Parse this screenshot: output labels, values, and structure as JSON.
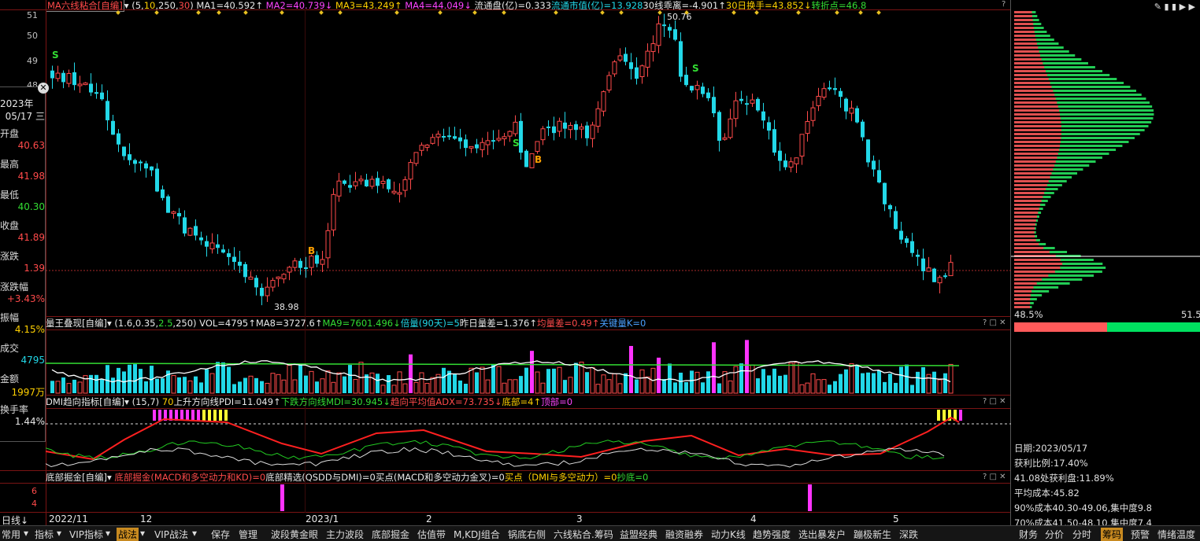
{
  "main_header": {
    "indicator": "MA六线粘合[自编]",
    "params_prefix": "(",
    "p1": "5",
    "c1": ",",
    "p2": "10",
    "c2": ",",
    "p3": "250",
    "c3": ",",
    "p4": "30",
    "params_suffix": ")",
    "ma1": "MA1=40.592↑",
    "ma2": "MA2=40.739↓",
    "ma3": "MA3=43.249↑",
    "ma4": "MA4=44.049↓",
    "flow": "流通盘(亿)=0.333",
    "mktval": "流通市值(亿)=13.928",
    "dev": "30线乖离=-4.901↑",
    "turn": "30日换手=43.852↓",
    "pivot": "转折点=46.8"
  },
  "price_labels": {
    "high": "50.76",
    "low": "38.98"
  },
  "y_ticks": [
    "51",
    "50",
    "49",
    "48"
  ],
  "signals": {
    "s": "S",
    "b": "B"
  },
  "info_panel": {
    "year": "2023年",
    "date": "05/17 三",
    "open_label": "开盘",
    "open": "40.63",
    "high_label": "最高",
    "high": "41.98",
    "low_label": "最低",
    "low": "40.30",
    "close_label": "收盘",
    "close": "41.89",
    "chg_label": "涨跌",
    "chg": "1.39",
    "chgpct_label": "涨跌幅",
    "chgpct": "+3.43%",
    "amp_label": "振幅",
    "amp": "4.15%",
    "vol_label": "成交",
    "vol": "4795",
    "amt_label": "金额",
    "amt": "1997万",
    "turn_label": "换手率",
    "turn": "1.44%"
  },
  "vol_header": {
    "name": "量王叠现[自编]",
    "params": "(1.6,0.35,",
    "p_green": "2.5",
    "p_end": ",250)",
    "vol": "VOL=4795↑",
    "ma8": "MA8=3727.6↑",
    "ma9": "MA9=7601.496↓",
    "ratio": "倍量(90天)=5",
    "diff": "昨日量差=1.376↑",
    "avgdiff": "均量差=0.49↑",
    "key": "关键量K=0"
  },
  "dmi_header": {
    "name": "DMI趋向指标[自编]",
    "params": "(15,7)",
    "lvl": "70",
    "pdi": "上升方向线PDI=11.049↑",
    "mdi": "下跌方向线MDI=30.945↓",
    "adx": "趋向平均值ADX=73.735↓",
    "bottom": "底部=4↑",
    "top": "顶部=0"
  },
  "bottom_header": {
    "name": "底部掘金[自编]",
    "a": "底部掘金(MACD和多空动力和KD)=0",
    "b": "底部精选(QSDD与DMI)=0",
    "c": "买点(MACD和多空动力金叉)=0",
    "d": "买点（DMI与多空动力）=0",
    "e": "抄底=0"
  },
  "bottom_ticks": [
    "6",
    "4"
  ],
  "x_axis": {
    "period": "日线",
    "dates": [
      "2022/11",
      "12",
      "2023/1",
      "2",
      "3",
      "4",
      "5"
    ]
  },
  "right_panel": {
    "left_pct": "48.5%",
    "right_pct": "51.5",
    "date": "日期:2023/05/17",
    "profit_ratio": "获利比例:17.40%",
    "profit_at": "41.08处获利盘:11.89%",
    "avg_cost": "平均成本:45.82",
    "cost90": "90%成本40.30-49.06,集中度9.8",
    "cost70": "70%成本41.50-48.10,集中度7.4"
  },
  "tabs": [
    "常用",
    "指标",
    "VIP指标",
    "战法",
    "VIP战法",
    "保存",
    "管理",
    "波段黄金眼",
    "主力波段",
    "底部掘金",
    "估值带",
    "M,KDJ组合",
    "锅底右侧",
    "六线粘合.筹码",
    "益盟经典",
    "融资融券",
    "动力K线",
    "趋势强度",
    "选出暴发户",
    "蹦极新生",
    "深跌"
  ],
  "right_tabs": [
    "财务",
    "分价",
    "分时",
    "筹码",
    "预警",
    "情绪温度"
  ],
  "colors": {
    "up": "#ff4a4a",
    "down": "#22d8e8",
    "ma": "#ffffff",
    "line_green": "#33dd33",
    "magenta": "#ff33ff",
    "yellow": "#ffff33"
  }
}
